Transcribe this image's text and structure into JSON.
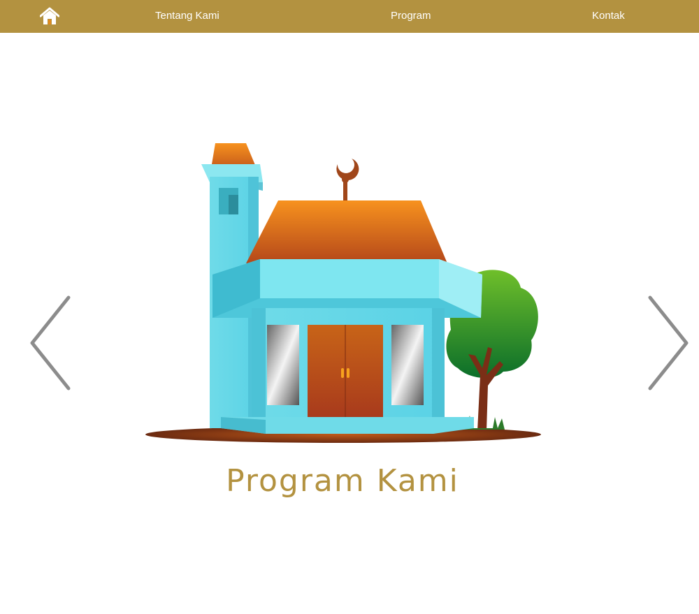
{
  "nav": {
    "home_icon": "home-icon",
    "links": [
      "Tentang Kami",
      "Program",
      "Kontak"
    ]
  },
  "slider": {
    "caption": "Program Kami",
    "prev_icon": "chevron-left-icon",
    "next_icon": "chevron-right-icon",
    "illustration": "mosque-illustration"
  },
  "colors": {
    "navbar": "#b39240",
    "caption": "#b39240",
    "arrows": "#8c8c8c"
  }
}
